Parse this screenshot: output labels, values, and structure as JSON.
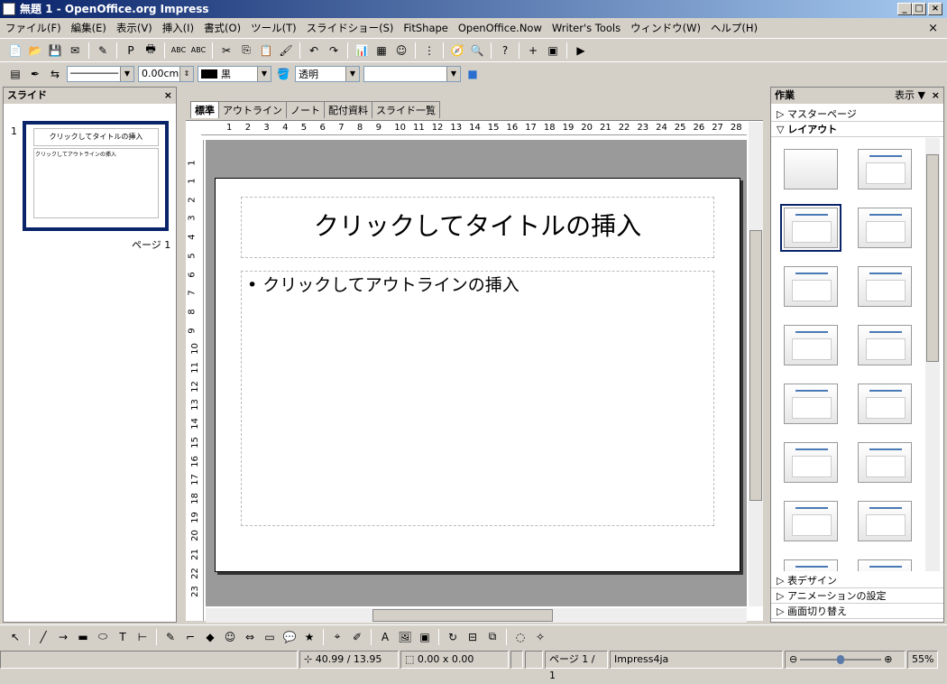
{
  "window": {
    "title": "無題 1 - OpenOffice.org Impress",
    "minimize": "_",
    "maximize": "□",
    "close": "×",
    "doc_close": "×"
  },
  "menu": [
    "ファイル(F)",
    "編集(E)",
    "表示(V)",
    "挿入(I)",
    "書式(O)",
    "ツール(T)",
    "スライドショー(S)",
    "FitShape",
    "OpenOffice.Now",
    "Writer's Tools",
    "ウィンドウ(W)",
    "ヘルプ(H)"
  ],
  "toolbar1": [
    [
      "new-document-icon",
      "📄"
    ],
    [
      "open-icon",
      "📂"
    ],
    [
      "save-icon",
      "💾"
    ],
    [
      "email-icon",
      "✉"
    ],
    [
      "sep",
      ""
    ],
    [
      "edit-file-icon",
      "✎"
    ],
    [
      "sep",
      ""
    ],
    [
      "export-pdf-icon",
      "P"
    ],
    [
      "print-icon",
      "🖶"
    ],
    [
      "sep",
      ""
    ],
    [
      "spellcheck-icon",
      "ABC"
    ],
    [
      "autospellcheck-icon",
      "ABC"
    ],
    [
      "sep",
      ""
    ],
    [
      "cut-icon",
      "✂"
    ],
    [
      "copy-icon",
      "⎘"
    ],
    [
      "paste-icon",
      "📋"
    ],
    [
      "format-paintbrush-icon",
      "🖌"
    ],
    [
      "sep",
      ""
    ],
    [
      "undo-icon",
      "↶"
    ],
    [
      "redo-icon",
      "↷"
    ],
    [
      "sep",
      ""
    ],
    [
      "chart-icon",
      "📊"
    ],
    [
      "table-icon",
      "▦"
    ],
    [
      "fontwork-icon",
      "☺"
    ],
    [
      "sep",
      ""
    ],
    [
      "grid-icon",
      "⋮"
    ],
    [
      "sep",
      ""
    ],
    [
      "navigator-icon",
      "🧭"
    ],
    [
      "zoom-icon",
      "🔍"
    ],
    [
      "sep",
      ""
    ],
    [
      "help-icon",
      "?"
    ],
    [
      "sep",
      ""
    ],
    [
      "new-slide-icon",
      "+"
    ],
    [
      "slide-design-icon",
      "▣"
    ],
    [
      "sep",
      ""
    ],
    [
      "slideshow-icon",
      "▶"
    ]
  ],
  "toolbar2": {
    "icons": [
      [
        "line-and-fill-icon",
        "▤"
      ],
      [
        "line-icon",
        "✒"
      ],
      [
        "arrow-style-icon",
        "⇆"
      ]
    ],
    "line_style": "────────",
    "line_width": "0.00cm",
    "line_color": "黒",
    "area_fill_icon": "area-style-icon",
    "area_style": "透明",
    "area_fill": "",
    "shadow_icon": "shadow-icon"
  },
  "slides_pane": {
    "title": "スライド",
    "close": "×",
    "slide_number": "1",
    "thumb_title": "クリックしてタイトルの挿入",
    "thumb_outline": "クリックしてアウトラインの挿入",
    "page_label": "ページ 1"
  },
  "view_tabs": [
    "標準",
    "アウトライン",
    "ノート",
    "配付資料",
    "スライド一覧"
  ],
  "ruler_h": [
    "1",
    "2",
    "3",
    "4",
    "5",
    "6",
    "7",
    "8",
    "9",
    "10",
    "11",
    "12",
    "13",
    "14",
    "15",
    "16",
    "17",
    "18",
    "19",
    "20",
    "21",
    "22",
    "23",
    "24",
    "25",
    "26",
    "27",
    "28"
  ],
  "ruler_v": [
    "1",
    "1",
    "2",
    "3",
    "4",
    "5",
    "6",
    "7",
    "8",
    "9",
    "10",
    "11",
    "12",
    "13",
    "14",
    "15",
    "16",
    "17",
    "18",
    "19",
    "20",
    "21",
    "22",
    "23"
  ],
  "slide": {
    "title_placeholder": "クリックしてタイトルの挿入",
    "outline_placeholder": "クリックしてアウトラインの挿入",
    "bullet": "•"
  },
  "tasks_pane": {
    "title": "作業",
    "view_menu": "表示 ▼",
    "close": "×",
    "sections_top": [
      {
        "label": "マスターページ",
        "expanded": false
      },
      {
        "label": "レイアウト",
        "expanded": true
      }
    ],
    "sections_bottom": [
      "表デザイン",
      "アニメーションの設定",
      "画面切り替え"
    ],
    "layouts": [
      "blank",
      "title-only-content",
      "title-content",
      "title-2-content",
      "title-only",
      "centered-text",
      "title-blank",
      "title-chart",
      "title-table",
      "title-image-content",
      "title-content-chart",
      "title-content-image",
      "chart-content",
      "content-blank",
      "more-1",
      "more-2"
    ],
    "selected_layout": 2
  },
  "drawing_toolbar": [
    [
      "select-icon",
      "↖"
    ],
    [
      "sep",
      ""
    ],
    [
      "line-icon",
      "╱"
    ],
    [
      "arrow-line-icon",
      "→"
    ],
    [
      "rectangle-icon",
      "▬"
    ],
    [
      "ellipse-icon",
      "⬭"
    ],
    [
      "text-icon",
      "T"
    ],
    [
      "vertical-text-icon",
      "⊢"
    ],
    [
      "sep",
      ""
    ],
    [
      "curve-icon",
      "✎"
    ],
    [
      "connector-icon",
      "⌐"
    ],
    [
      "basic-shapes-icon",
      "◆"
    ],
    [
      "symbol-shapes-icon",
      "☺"
    ],
    [
      "block-arrows-icon",
      "⇔"
    ],
    [
      "flowchart-icon",
      "▭"
    ],
    [
      "callout-icon",
      "💬"
    ],
    [
      "stars-icon",
      "★"
    ],
    [
      "sep",
      ""
    ],
    [
      "points-icon",
      "⌖"
    ],
    [
      "glue-points-icon",
      "✐"
    ],
    [
      "sep",
      ""
    ],
    [
      "fontwork-gallery-icon",
      "A"
    ],
    [
      "from-file-icon",
      "🖼"
    ],
    [
      "gallery-icon",
      "▣"
    ],
    [
      "sep",
      ""
    ],
    [
      "rotate-icon",
      "↻"
    ],
    [
      "align-icon",
      "⊟"
    ],
    [
      "arrange-icon",
      "⧉"
    ],
    [
      "sep",
      ""
    ],
    [
      "extrusion-icon",
      "◌"
    ],
    [
      "toggle-extrusion-icon",
      "✧"
    ]
  ],
  "status": {
    "position": "40.99 / 13.95",
    "size": "0.00 x 0.00",
    "page": "ページ 1 / 1",
    "master": "Impress4ja",
    "zoom_percent": "55%",
    "zoom_level": 55
  },
  "colors": {
    "title_start": "#0a246a",
    "title_end": "#a6caf0",
    "accent": "#4a7ab5",
    "selected_border": "#0a246a",
    "canvas": "#9a9a9a"
  }
}
